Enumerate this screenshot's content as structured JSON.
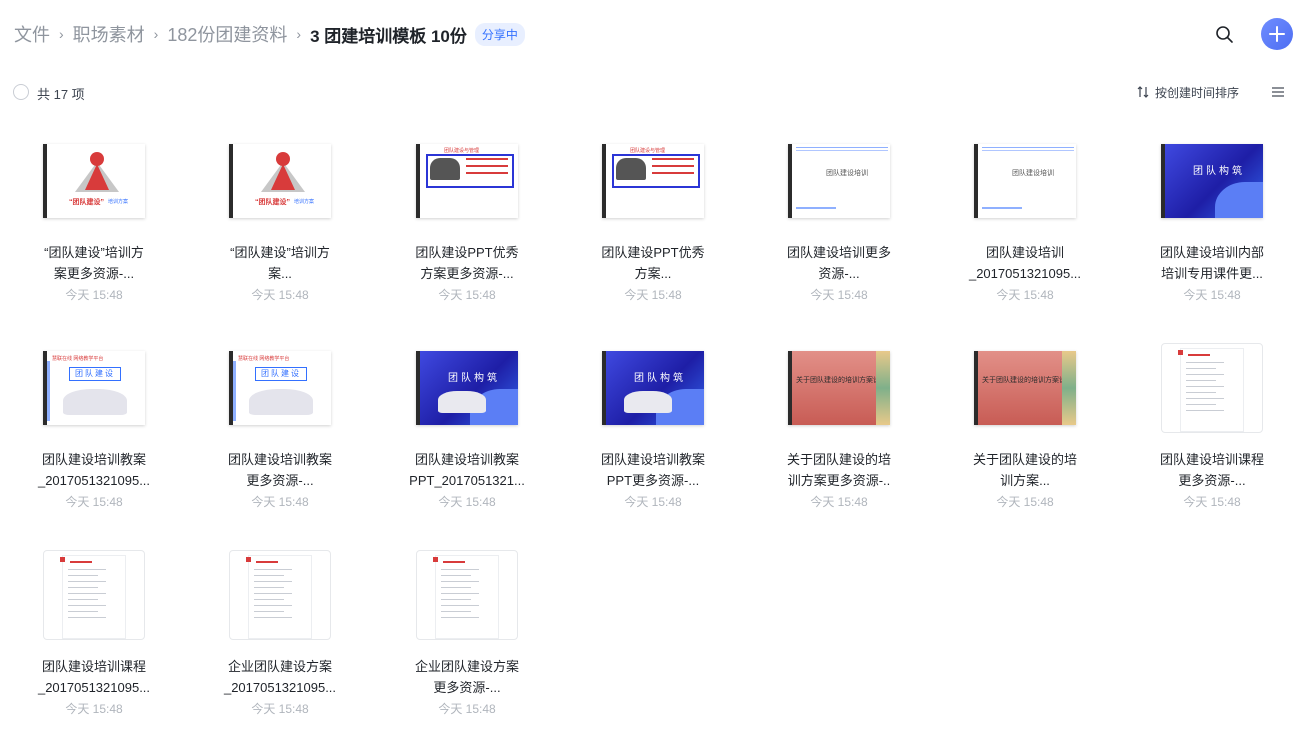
{
  "breadcrumb": {
    "items": [
      "文件",
      "职场素材",
      "182份团建资料"
    ],
    "current": "3 团建培训模板 10份",
    "badge": "分享中"
  },
  "header": {
    "search_icon": "search-icon",
    "add_icon": "plus-icon",
    "accent_color": "#4e6ef2"
  },
  "toolbar": {
    "count_label": "共 17 项",
    "sort_label": "按创建时间排序",
    "list_icon": "list-view-icon"
  },
  "files": [
    {
      "name": "“团队建设”培训方\n案更多资源-...",
      "time": "今天 15:48",
      "thumb": "red"
    },
    {
      "name": "“团队建设”培训方\n案...",
      "time": "今天 15:48",
      "thumb": "red"
    },
    {
      "name": "团队建设PPT优秀\n方案更多资源-...",
      "time": "今天 15:48",
      "thumb": "blueframe"
    },
    {
      "name": "团队建设PPT优秀\n方案...",
      "time": "今天 15:48",
      "thumb": "blueframe"
    },
    {
      "name": "团队建设培训更多\n资源-...",
      "time": "今天 15:48",
      "thumb": "white"
    },
    {
      "name": "团队建设培训\n_2017051321095...",
      "time": "今天 15:48",
      "thumb": "white"
    },
    {
      "name": "团队建设培训内部\n培训专用课件更...",
      "time": "今天 15:48",
      "thumb": "gradient"
    },
    {
      "name": "团队建设培训教案\n_2017051321095...",
      "time": "今天 15:48",
      "thumb": "whiteblue"
    },
    {
      "name": "团队建设培训教案\n更多资源-...",
      "time": "今天 15:48",
      "thumb": "whiteblue"
    },
    {
      "name": "团队建设培训教案\nPPT_2017051321...",
      "time": "今天 15:48",
      "thumb": "gradient2"
    },
    {
      "name": "团队建设培训教案\nPPT更多资源-...",
      "time": "今天 15:48",
      "thumb": "gradient2"
    },
    {
      "name": "关于团队建设的培\n训方案更多资源-..",
      "time": "今天 15:48",
      "thumb": "salmon"
    },
    {
      "name": "关于团队建设的培\n训方案...",
      "time": "今天 15:48",
      "thumb": "salmon"
    },
    {
      "name": "团队建设培训课程\n更多资源-...",
      "time": "今天 15:48",
      "thumb": "doc"
    },
    {
      "name": "团队建设培训课程\n_2017051321095...",
      "time": "今天 15:48",
      "thumb": "doc"
    },
    {
      "name": "企业团队建设方案\n_2017051321095...",
      "time": "今天 15:48",
      "thumb": "doc"
    },
    {
      "name": "企业团队建设方案\n更多资源-...",
      "time": "今天 15:48",
      "thumb": "doc"
    }
  ],
  "thumb_text": {
    "red_caption": "“团队建设”",
    "red_sub": "培训方案",
    "blueframe_title": "团队建设与管理",
    "white_title": "团队建设培训",
    "gradient_title": "团队构筑",
    "whiteblue_logo": "慧联在线 网络教学平台",
    "whiteblue_box": "团队建设",
    "salmon_title": "关于团队建设的培训方案设计"
  }
}
